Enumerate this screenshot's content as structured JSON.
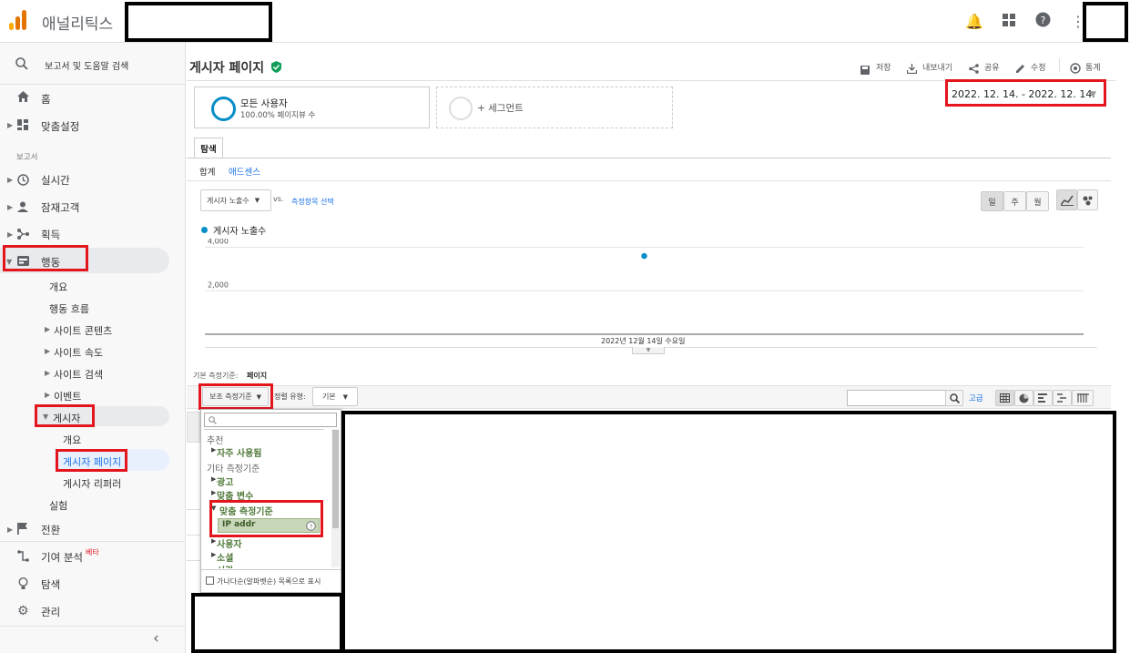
{
  "app": {
    "title": "애널리틱스"
  },
  "sidebar": {
    "search_label": "보고서 및 도움말 검색",
    "home": "홈",
    "customization": "맞춤설정",
    "reports_header": "보고서",
    "realtime": "실시간",
    "audience": "잠재고객",
    "acquisition": "획득",
    "behavior": "행동",
    "behavior_items": [
      "개요",
      "행동 흐름",
      "사이트 콘텐츠",
      "사이트 속도",
      "사이트 검색",
      "이벤트"
    ],
    "publisher": "게시자",
    "publisher_items": [
      "개요",
      "게시자 페이지",
      "게시자 리퍼러"
    ],
    "experiments": "실험",
    "conversions": "전환",
    "attribution": "기여 분석",
    "attribution_badge": "베타",
    "discover": "탐색",
    "admin": "관리",
    "collapse": "‹"
  },
  "header": {
    "page_title": "게시자 페이지",
    "actions": [
      "저장",
      "내보내기",
      "공유",
      "수정",
      "통계"
    ]
  },
  "segments": {
    "all_users_title": "모든 사용자",
    "all_users_sub": "100.00% 페이지뷰 수",
    "add_segment": "+ 세그먼트"
  },
  "date_range": "2022. 12. 14. - 2022. 12. 14.",
  "tabs": {
    "explore": "탐색",
    "subtabs": [
      "합계",
      "애드센스"
    ]
  },
  "metric_controls": {
    "metric_select": "게시자 노출수",
    "vs": "vs.",
    "select_metric": "측정항목 선택",
    "period_buttons": [
      "일",
      "주",
      "월"
    ]
  },
  "chart_data": {
    "type": "scatter",
    "title": "",
    "legend": "게시자 노출수",
    "x": [
      "2022년 12월 14일 수요일"
    ],
    "values": [
      3600
    ],
    "yticks": [
      "4,000",
      "2,000"
    ],
    "ylim": [
      0,
      4400
    ],
    "xlabel": "2022년 12월 14일 수요일"
  },
  "dimension": {
    "label": "기본 측정기준:",
    "value": "페이지"
  },
  "table_controls": {
    "secondary_dimension": "보조 측정기준",
    "sort_type_label": "정렬 유형:",
    "sort_type_value": "기본",
    "advanced": "고급"
  },
  "dropdown": {
    "recommended": "추천",
    "frequently_used": "자주 사용됨",
    "other_dimensions": "기타 측정기준",
    "items": [
      "광고",
      "맞춤 변수",
      "맞춤 측정기준",
      "IP addr",
      "사용자",
      "소셜",
      "시간"
    ],
    "alphabetical": "가나다순(알파벳순) 목록으로 표시"
  },
  "colors": {
    "accent": "#1a73e8",
    "red": "#e3161e",
    "dot": "#058dc7"
  }
}
